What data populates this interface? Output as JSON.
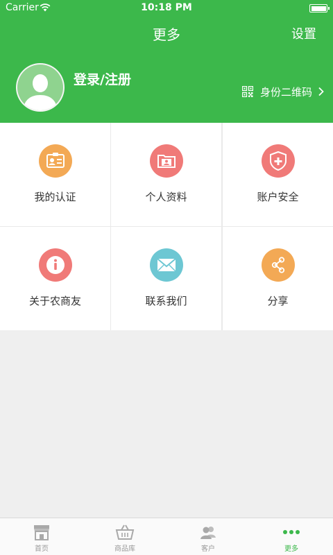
{
  "status_bar": {
    "carrier": "Carrier",
    "time": "10:18 PM"
  },
  "header": {
    "title": "更多",
    "settings_label": "设置"
  },
  "profile": {
    "login_label": "登录/注册",
    "qr_label": "身份二维码"
  },
  "menu": [
    {
      "label": "我的认证",
      "icon": "id-card-icon",
      "color": "#f3a955"
    },
    {
      "label": "个人资料",
      "icon": "folder-profile-icon",
      "color": "#f07a78"
    },
    {
      "label": "账户安全",
      "icon": "shield-plus-icon",
      "color": "#f07a78"
    },
    {
      "label": "关于农商友",
      "icon": "info-icon",
      "color": "#f07a78"
    },
    {
      "label": "联系我们",
      "icon": "envelope-icon",
      "color": "#6dc7d3"
    },
    {
      "label": "分享",
      "icon": "share-icon",
      "color": "#f3a955"
    }
  ],
  "tabbar": [
    {
      "label": "首页",
      "icon": "store-icon",
      "active": false
    },
    {
      "label": "商品库",
      "icon": "basket-icon",
      "active": false
    },
    {
      "label": "客户",
      "icon": "users-icon",
      "active": false
    },
    {
      "label": "更多",
      "icon": "more-dots-icon",
      "active": true
    }
  ],
  "colors": {
    "primary_green": "#3cb84b",
    "background": "#efefef",
    "tab_inactive": "#9a9a9a"
  }
}
